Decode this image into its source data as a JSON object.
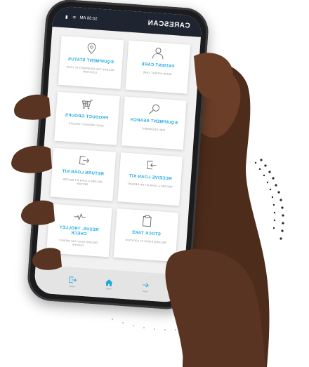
{
  "app": {
    "title": "CARESCAN",
    "time": "10:36 AM"
  },
  "tiles": [
    {
      "title": "PATIENT CARE",
      "subtitle": "BEGIN PATIENT CARE",
      "icon": "person-icon"
    },
    {
      "title": "EQUIPMENT STATUS",
      "subtitle": "RECORD THE EQUIPMENT AT YOUR LOCATION",
      "icon": "location-pin-icon"
    },
    {
      "title": "EQUIPMENT SEARCH",
      "subtitle": "FIND EQUIPMENT",
      "icon": "magnifier-icon"
    },
    {
      "title": "PRODUCT GROUPS",
      "subtitle": "BUILD PRODUCT GROUPS",
      "icon": "cart-icon"
    },
    {
      "title": "RECEIVE LOAN KIT",
      "subtitle": "RECORD A LOAN KIT ON RECEIPT",
      "icon": "sign-in-icon"
    },
    {
      "title": "RETURN LOAN KIT",
      "subtitle": "RECORD A LOAN KIT BEFORE RETURN",
      "icon": "sign-out-icon"
    },
    {
      "title": "STOCK TAKE",
      "subtitle": "RECORD STOCK AT LOCATION",
      "icon": "clipboard-icon"
    },
    {
      "title": "RESUS. TROLLEY CHECK",
      "subtitle": "RECORD DAILY AND WEEKLY CHECKS",
      "icon": "heartbeat-icon"
    }
  ],
  "nav": [
    {
      "label": "Logout",
      "icon": "logout-icon"
    },
    {
      "label": "Home",
      "icon": "home-icon"
    },
    {
      "label": "Back",
      "icon": "back-arrow-icon"
    }
  ],
  "colors": {
    "accent": "#1aa9e0",
    "status_bar": "#1f2530",
    "screen_bg": "#f1f1f1",
    "hand": "#5a3422"
  }
}
